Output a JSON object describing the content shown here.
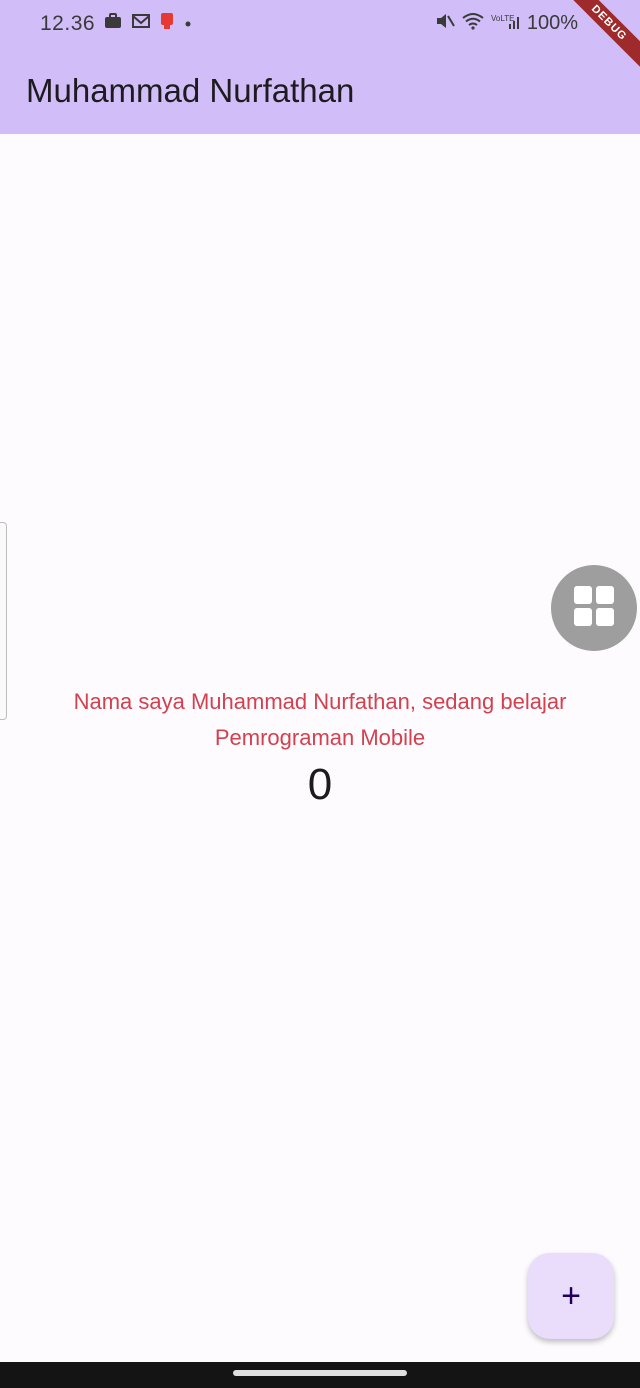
{
  "status_bar": {
    "time": "12.36",
    "battery": "100%",
    "left_icons": [
      "briefcase-icon",
      "mail-icon",
      "notification-icon",
      "dot-icon"
    ],
    "right_icons": [
      "mute-icon",
      "wifi-icon",
      "signal-icon"
    ]
  },
  "app_bar": {
    "title": "Muhammad Nurfathan",
    "background": "#d1bdf7"
  },
  "debug_ribbon": {
    "label": "DEBUG"
  },
  "main": {
    "message": "Nama saya Muhammad Nurfathan, sedang belajar Pemrograman Mobile",
    "message_color": "#d3414f",
    "counter": "0"
  },
  "floating_widget": {
    "icon": "grid-icon"
  },
  "fab": {
    "icon": "plus-icon",
    "label": "+"
  }
}
